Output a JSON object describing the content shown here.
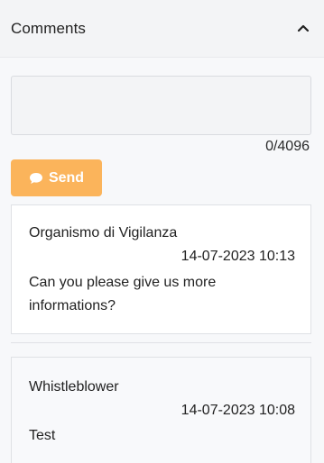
{
  "header": {
    "title": "Comments",
    "collapse_icon": "chevron-up-icon"
  },
  "composer": {
    "value": "",
    "placeholder": "",
    "counter": "0/4096",
    "send_label": "Send",
    "send_icon": "chat-bubble-icon"
  },
  "colors": {
    "send_button": "#fbb45b",
    "header_bg": "#f3f4f6"
  },
  "comments": [
    {
      "author": "Organismo di Vigilanza",
      "timestamp": "14-07-2023 10:13",
      "message": "Can you please give us more informations?"
    },
    {
      "author": "Whistleblower",
      "timestamp": "14-07-2023 10:08",
      "message": "Test"
    }
  ]
}
